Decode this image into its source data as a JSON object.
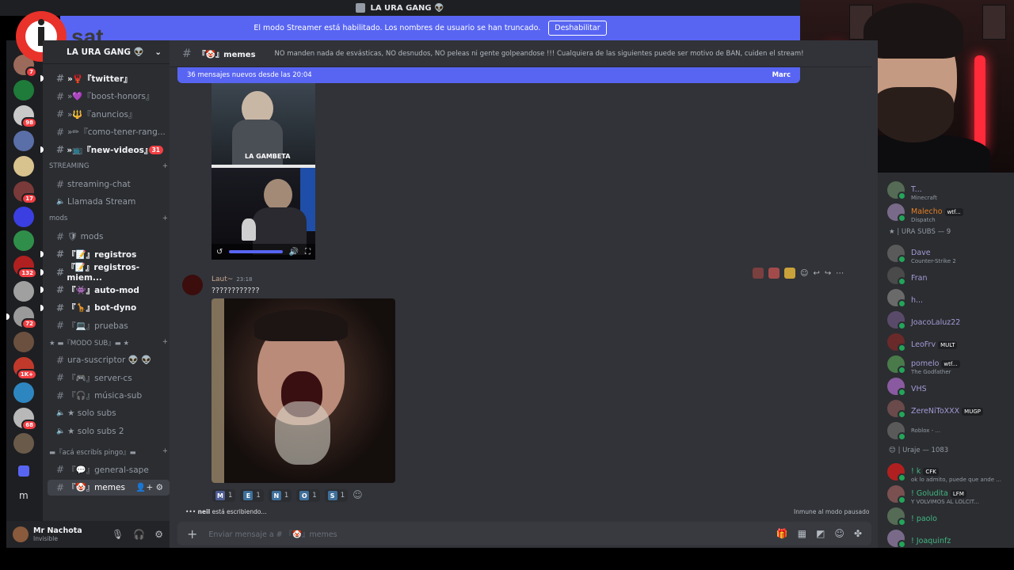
{
  "title_bar": {
    "text": "LA URA GANG 👽"
  },
  "banner": {
    "text": "El modo Streamer está habilitado. Los nombres de usuario se han truncado.",
    "button": "Deshabilitar"
  },
  "logo": {
    "text": "I sat"
  },
  "server_rail": {
    "badges": [
      "7",
      "98",
      "17",
      "132",
      "72",
      "1K+",
      "68"
    ],
    "bottom_letter": "m"
  },
  "server": {
    "name": "LA URA GANG 👽"
  },
  "channels": {
    "top": [
      {
        "label": "»🦞『twitter』",
        "unread": true
      },
      {
        "label": "»💜『boost-honors』",
        "unread": false
      },
      {
        "label": "»🔱『anuncios』",
        "unread": false
      },
      {
        "label": "»✏『como-tener-rang...",
        "unread": false
      },
      {
        "label": "»📺『new-videos』",
        "unread": true,
        "mention": "31"
      }
    ],
    "streaming_category": "STREAMING",
    "streaming": [
      {
        "label": "streaming-chat",
        "type": "text"
      },
      {
        "label": "Llamada Stream",
        "type": "voice"
      }
    ],
    "mods_category": "mods",
    "mods": [
      {
        "label": "🛡 mods",
        "type": "text",
        "unread": false
      },
      {
        "label": "『📝』registros",
        "type": "text",
        "unread": true
      },
      {
        "label": "『📝』registros-miem...",
        "type": "text",
        "unread": true
      },
      {
        "label": "『👾』auto-mod",
        "type": "text",
        "unread": true
      },
      {
        "label": "『🦒』bot-dyno",
        "type": "text",
        "unread": true
      },
      {
        "label": "『💻』pruebas",
        "type": "text",
        "unread": false
      }
    ],
    "sub_category": "★ ▬『MODO SUB』▬ ★",
    "sub": [
      {
        "label": "ura-suscriptor 👽 👽",
        "type": "text"
      },
      {
        "label": "『🎮』server-cs",
        "type": "text"
      },
      {
        "label": "『🎧』música-sub",
        "type": "text"
      },
      {
        "label": "★ solo subs",
        "type": "voice"
      },
      {
        "label": "★ solo subs 2",
        "type": "voice"
      }
    ],
    "general_category": "▬『acá escribís pingo』▬",
    "general": [
      {
        "label": "『💬』general-sape",
        "type": "text"
      },
      {
        "label": "『🤡』memes",
        "type": "text",
        "active": true
      }
    ]
  },
  "user": {
    "name": "Mr Nachota",
    "status": "Invisible"
  },
  "chat": {
    "channel": "『🤡』memes",
    "topic": "NO manden nada de esvásticas, NO desnudos, NO peleas ni gente golpeandose !!! Cualquiera de las siguientes puede ser motivo de BAN, cuiden el stream!",
    "new_messages": "36 mensajes nuevos desde las 20:04",
    "mark_read": "Marc",
    "embed_caption": "LA GAMBETA",
    "message": {
      "author": "Laut~",
      "time": "23:18",
      "text": "????????????"
    },
    "reactions": [
      {
        "emoji": "M",
        "count": "1",
        "color": "#4e5d94"
      },
      {
        "emoji": "E",
        "count": "1",
        "color": "#3f6f9a"
      },
      {
        "emoji": "N",
        "count": "1",
        "color": "#3f6f9a"
      },
      {
        "emoji": "O",
        "count": "1",
        "color": "#3f6f9a"
      },
      {
        "emoji": "S",
        "count": "1",
        "color": "#3f6f9a"
      }
    ],
    "typing_user": "neil",
    "typing_text": " está escribiendo...",
    "slowmode": "Inmune al modo pausado",
    "composer_placeholder": "Enviar mensaje a # 『🤡』memes"
  },
  "members": {
    "top": [
      {
        "name": "T...",
        "activity": "Minecraft",
        "color": "#a39bd6"
      },
      {
        "name": "Malecho",
        "tag": "wtf...",
        "activity": "Dispatch",
        "color": "#e67e22"
      }
    ],
    "ura_subs_header": "★ | URA SUBS — 9",
    "ura_subs": [
      {
        "name": "Dave",
        "activity": "Counter-Strike 2",
        "color": "#a39bd6"
      },
      {
        "name": "Fran",
        "activity": "",
        "color": "#a39bd6"
      },
      {
        "name": "h...",
        "activity": "",
        "color": "#a39bd6"
      },
      {
        "name": "JoacoLaluz22",
        "activity": "",
        "color": "#a39bd6"
      },
      {
        "name": "LeoFrv",
        "tag": "MULT",
        "activity": "",
        "color": "#a39bd6"
      },
      {
        "name": "pomelo",
        "tag": "wtf...",
        "activity": "The Godfather",
        "color": "#a39bd6"
      },
      {
        "name": "VHS",
        "activity": "",
        "color": "#a39bd6"
      },
      {
        "name": "ZereNiToXXX",
        "tag": "MUGP",
        "activity": "",
        "color": "#a39bd6"
      },
      {
        "name": "",
        "activity": "Roblox - ...",
        "color": "#a39bd6"
      }
    ],
    "uraje_header": "😊 | Uraje — 1083",
    "uraje": [
      {
        "name": "! k",
        "tag": "CFK",
        "activity": "ok lo admito, puede que ande ...",
        "color": "#43b581"
      },
      {
        "name": "! Goludita",
        "tag": "LFM",
        "activity": "Y VOLVIMOS AL LOLCIT...",
        "color": "#43b581"
      },
      {
        "name": "! paolo",
        "activity": "",
        "color": "#43b581"
      },
      {
        "name": "! Joaquinfz",
        "activity": "",
        "color": "#43b581"
      }
    ]
  },
  "colors": {
    "accent": "#5865f2",
    "bg": "#313338",
    "sidebar": "#2b2d31",
    "rail": "#1e1f22",
    "mention": "#f23f43",
    "online": "#23a55a"
  }
}
